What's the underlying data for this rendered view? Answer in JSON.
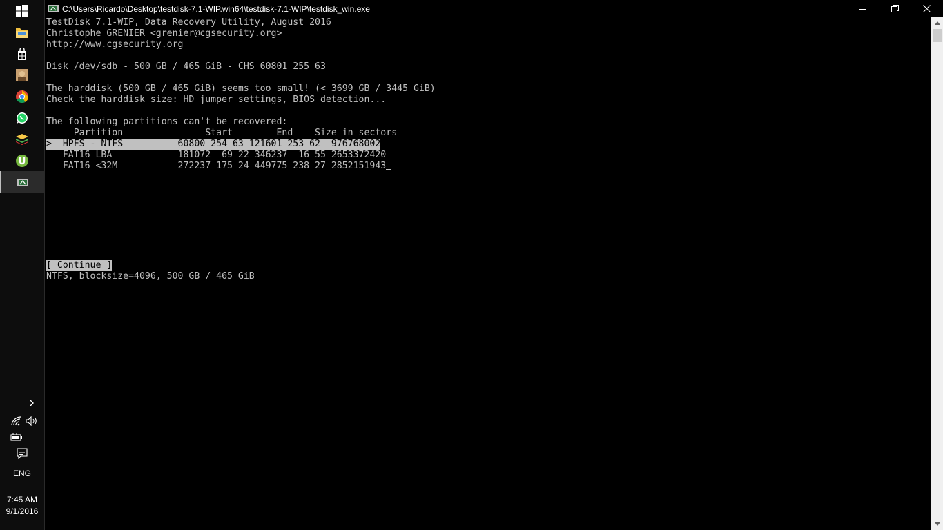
{
  "taskbar": {
    "icons": [
      "windows-start-icon",
      "file-explorer-icon",
      "store-icon",
      "user-photo-icon",
      "chrome-icon",
      "whatsapp-icon",
      "bluestacks-icon",
      "utorrent-icon",
      "testdisk-icon"
    ],
    "tray": {
      "expand_icon": "chevron-right-icon",
      "network_icon": "wifi-icon",
      "volume_icon": "speaker-icon",
      "battery_icon": "battery-icon",
      "notifications_icon": "action-center-icon",
      "language": "ENG",
      "time": "7:45 AM",
      "date": "9/1/2016"
    }
  },
  "window": {
    "title": "C:\\Users\\Ricardo\\Desktop\\testdisk-7.1-WIP.win64\\testdisk-7.1-WIP\\testdisk_win.exe",
    "controls": [
      "minimize-icon",
      "restore-icon",
      "close-icon"
    ]
  },
  "console": {
    "header": [
      "TestDisk 7.1-WIP, Data Recovery Utility, August 2016",
      "Christophe GRENIER <grenier@cgsecurity.org>",
      "http://www.cgsecurity.org"
    ],
    "disk": "Disk /dev/sdb - 500 GB / 465 GiB - CHS 60801 255 63",
    "warning": [
      "The harddisk (500 GB / 465 GiB) seems too small! (< 3699 GB / 3445 GiB)",
      "Check the harddisk size: HD jumper settings, BIOS detection..."
    ],
    "partitions_intro": "The following partitions can't be recovered:",
    "columns_header": "     Partition               Start        End    Size in sectors",
    "partitions": [
      {
        "text": ">  HPFS - NTFS          60800 254 63 121601 253 62  976768002",
        "selected": true
      },
      {
        "text": "   FAT16 LBA            181072  69 22 346237  16 55 2653372420",
        "selected": false
      },
      {
        "text": "   FAT16 <32M           272237 175 24 449775 238 27 2852151943",
        "selected": false
      }
    ],
    "continue_button": "[ Continue ]",
    "status": "NTFS, blocksize=4096, 500 GB / 465 GiB"
  },
  "colors": {
    "console_bg": "#000000",
    "console_text": "#c0c0c0",
    "highlight_bg": "#c0c0c0",
    "taskbar_bg": "#0d0d0d"
  }
}
